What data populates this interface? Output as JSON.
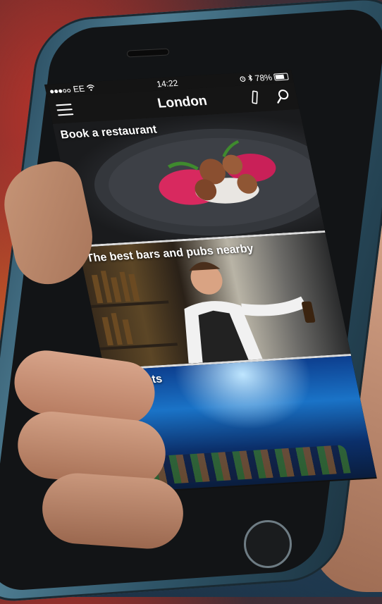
{
  "status_bar": {
    "carrier": "EE",
    "time": "14:22",
    "battery": "78%"
  },
  "nav": {
    "title": "London"
  },
  "tiles": [
    {
      "label": "Book a restaurant"
    },
    {
      "label": "The best bars and pubs nearby"
    },
    {
      "label": "ot tickets"
    }
  ],
  "icons": [
    "menu-icon",
    "pencil-icon",
    "search-icon",
    "wifi-icon",
    "alarm-icon",
    "bluetooth-icon",
    "battery-icon"
  ]
}
